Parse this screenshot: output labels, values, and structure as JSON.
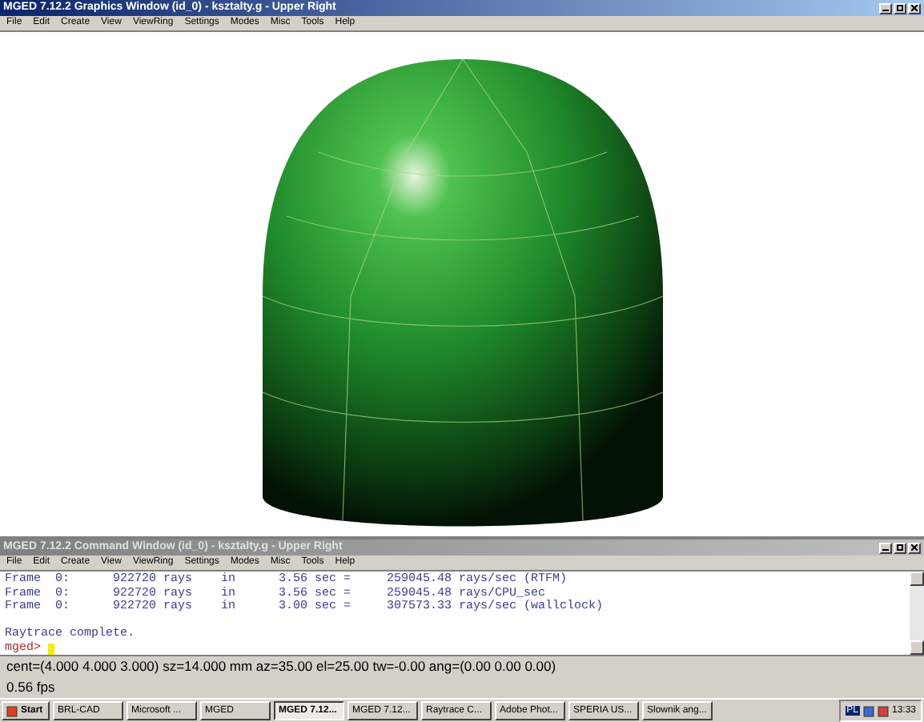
{
  "graphics_window": {
    "title": "MGED 7.12.2 Graphics Window (id_0) - ksztalty.g - Upper Right",
    "menu": [
      "File",
      "Edit",
      "Create",
      "View",
      "ViewRing",
      "Settings",
      "Modes",
      "Misc",
      "Tools",
      "Help"
    ]
  },
  "command_window": {
    "title": "MGED 7.12.2 Command Window (id_0) - ksztalty.g - Upper Right",
    "menu": [
      "File",
      "Edit",
      "Create",
      "View",
      "ViewRing",
      "Settings",
      "Modes",
      "Misc",
      "Tools",
      "Help"
    ],
    "lines": [
      {
        "kind": "output",
        "text": "Frame  0:      922720 rays    in      3.56 sec =     259045.48 rays/sec (RTFM)"
      },
      {
        "kind": "output",
        "text": "Frame  0:      922720 rays    in      3.56 sec =     259045.48 rays/CPU_sec"
      },
      {
        "kind": "output",
        "text": "Frame  0:      922720 rays    in      3.00 sec =     307573.33 rays/sec (wallclock)"
      },
      {
        "kind": "blank"
      },
      {
        "kind": "output",
        "text": "Raytrace complete."
      },
      {
        "kind": "prompt",
        "text": "mged>"
      }
    ]
  },
  "status_line": "cent=(4.000 4.000 3.000)  sz=14.000  mm  az=35.00  el=25.00  tw=-0.00  ang=(0.00 0.00 0.00)",
  "fps": "0.56 fps",
  "taskbar": {
    "start": "Start",
    "items": [
      {
        "label": "BRL-CAD",
        "selected": false
      },
      {
        "label": "Microsoft ...",
        "selected": false
      },
      {
        "label": "MGED",
        "selected": false
      },
      {
        "label": "MGED 7.12...",
        "selected": true
      },
      {
        "label": "MGED 7.12...",
        "selected": false
      },
      {
        "label": "Raytrace C...",
        "selected": false
      },
      {
        "label": "Adobe Phot...",
        "selected": false
      },
      {
        "label": "SPERIA US...",
        "selected": false
      },
      {
        "label": "Slownik ang...",
        "selected": false
      }
    ],
    "language": "PL",
    "clock": "13:33"
  }
}
